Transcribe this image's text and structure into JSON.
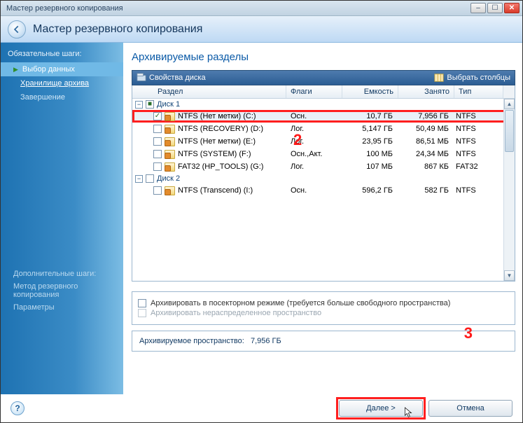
{
  "window": {
    "title": "Мастер резервного копирования"
  },
  "header": {
    "title": "Мастер резервного копирования"
  },
  "sidebar": {
    "section1_title": "Обязательные шаги:",
    "step_select": "Выбор данных",
    "step_archive": "Хранилище архива",
    "step_finish": "Завершение",
    "section2_title": "Дополнительные шаги:",
    "opt_method": "Метод резервного копирования",
    "opt_params": "Параметры"
  },
  "main": {
    "title": "Архивируемые разделы"
  },
  "toolbar": {
    "props": "Свойства диска",
    "columns": "Выбрать столбцы"
  },
  "table": {
    "headers": {
      "partition": "Раздел",
      "flags": "Флаги",
      "capacity": "Емкость",
      "used": "Занято",
      "type": "Тип"
    },
    "disk1": "Диск 1",
    "disk2": "Диск 2",
    "rows_d1": [
      {
        "checked": true,
        "name": "NTFS (Нет метки) (C:)",
        "flags": "Осн.",
        "cap": "10,7 ГБ",
        "used": "7,956 ГБ",
        "type": "NTFS",
        "hl": true
      },
      {
        "checked": false,
        "name": "NTFS (RECOVERY) (D:)",
        "flags": "Лог.",
        "cap": "5,147 ГБ",
        "used": "50,49 МБ",
        "type": "NTFS"
      },
      {
        "checked": false,
        "name": "NTFS (Нет метки) (E:)",
        "flags": "Лог.",
        "cap": "23,95 ГБ",
        "used": "86,51 МБ",
        "type": "NTFS"
      },
      {
        "checked": false,
        "name": "NTFS (SYSTEM) (F:)",
        "flags": "Осн.,Акт.",
        "cap": "100 МБ",
        "used": "24,34 МБ",
        "type": "NTFS"
      },
      {
        "checked": false,
        "name": "FAT32 (HP_TOOLS) (G:)",
        "flags": "Лог.",
        "cap": "107 МБ",
        "used": "867 КБ",
        "type": "FAT32"
      }
    ],
    "rows_d2": [
      {
        "checked": false,
        "name": "NTFS (Transcend) (I:)",
        "flags": "Осн.",
        "cap": "596,2 ГБ",
        "used": "582 ГБ",
        "type": "NTFS"
      }
    ]
  },
  "options": {
    "sector": "Архивировать в посекторном режиме (требуется больше свободного пространства)",
    "unalloc": "Архивировать нераспределенное пространство"
  },
  "spacebox": {
    "label": "Архивируемое пространство:",
    "value": "7,956 ГБ"
  },
  "buttons": {
    "next": "Далее >",
    "cancel": "Отмена"
  },
  "annotations": {
    "two": "2",
    "three": "3"
  }
}
